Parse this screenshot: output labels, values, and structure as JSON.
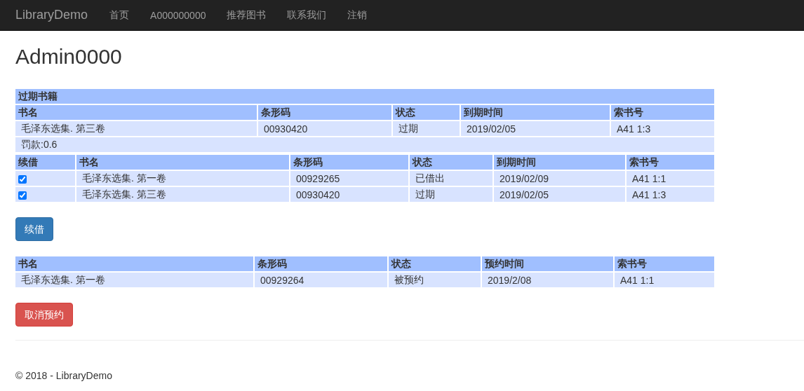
{
  "navbar": {
    "brand": "LibraryDemo",
    "links": [
      "首页",
      "A000000000",
      "推荐图书",
      "联系我们",
      "注销"
    ]
  },
  "heading": "Admin0000",
  "overdue": {
    "title": "过期书籍",
    "columns": [
      "书名",
      "条形码",
      "状态",
      "到期时间",
      "索书号"
    ],
    "rows": [
      [
        "毛泽东选集. 第三卷",
        "00930420",
        "过期",
        "2019/02/05",
        "A41 1:3"
      ]
    ],
    "fine": "罚款:0.6"
  },
  "renew": {
    "checkbox_column": "续借",
    "columns": [
      "书名",
      "条形码",
      "状态",
      "到期时间",
      "索书号"
    ],
    "rows": [
      {
        "checked": true,
        "cells": [
          "毛泽东选集. 第一卷",
          "00929265",
          "已借出",
          "2019/02/09",
          "A41 1:1"
        ]
      },
      {
        "checked": true,
        "cells": [
          "毛泽东选集. 第三卷",
          "00930420",
          "过期",
          "2019/02/05",
          "A41 1:3"
        ]
      }
    ],
    "button": "续借"
  },
  "reservations": {
    "columns": [
      "书名",
      "条形码",
      "状态",
      "预约时间",
      "索书号"
    ],
    "rows": [
      [
        "毛泽东选集. 第一卷",
        "00929264",
        "被预约",
        "2019/2/08",
        "A41 1:1"
      ]
    ],
    "button": "取消预约"
  },
  "footer": "© 2018 - LibraryDemo"
}
